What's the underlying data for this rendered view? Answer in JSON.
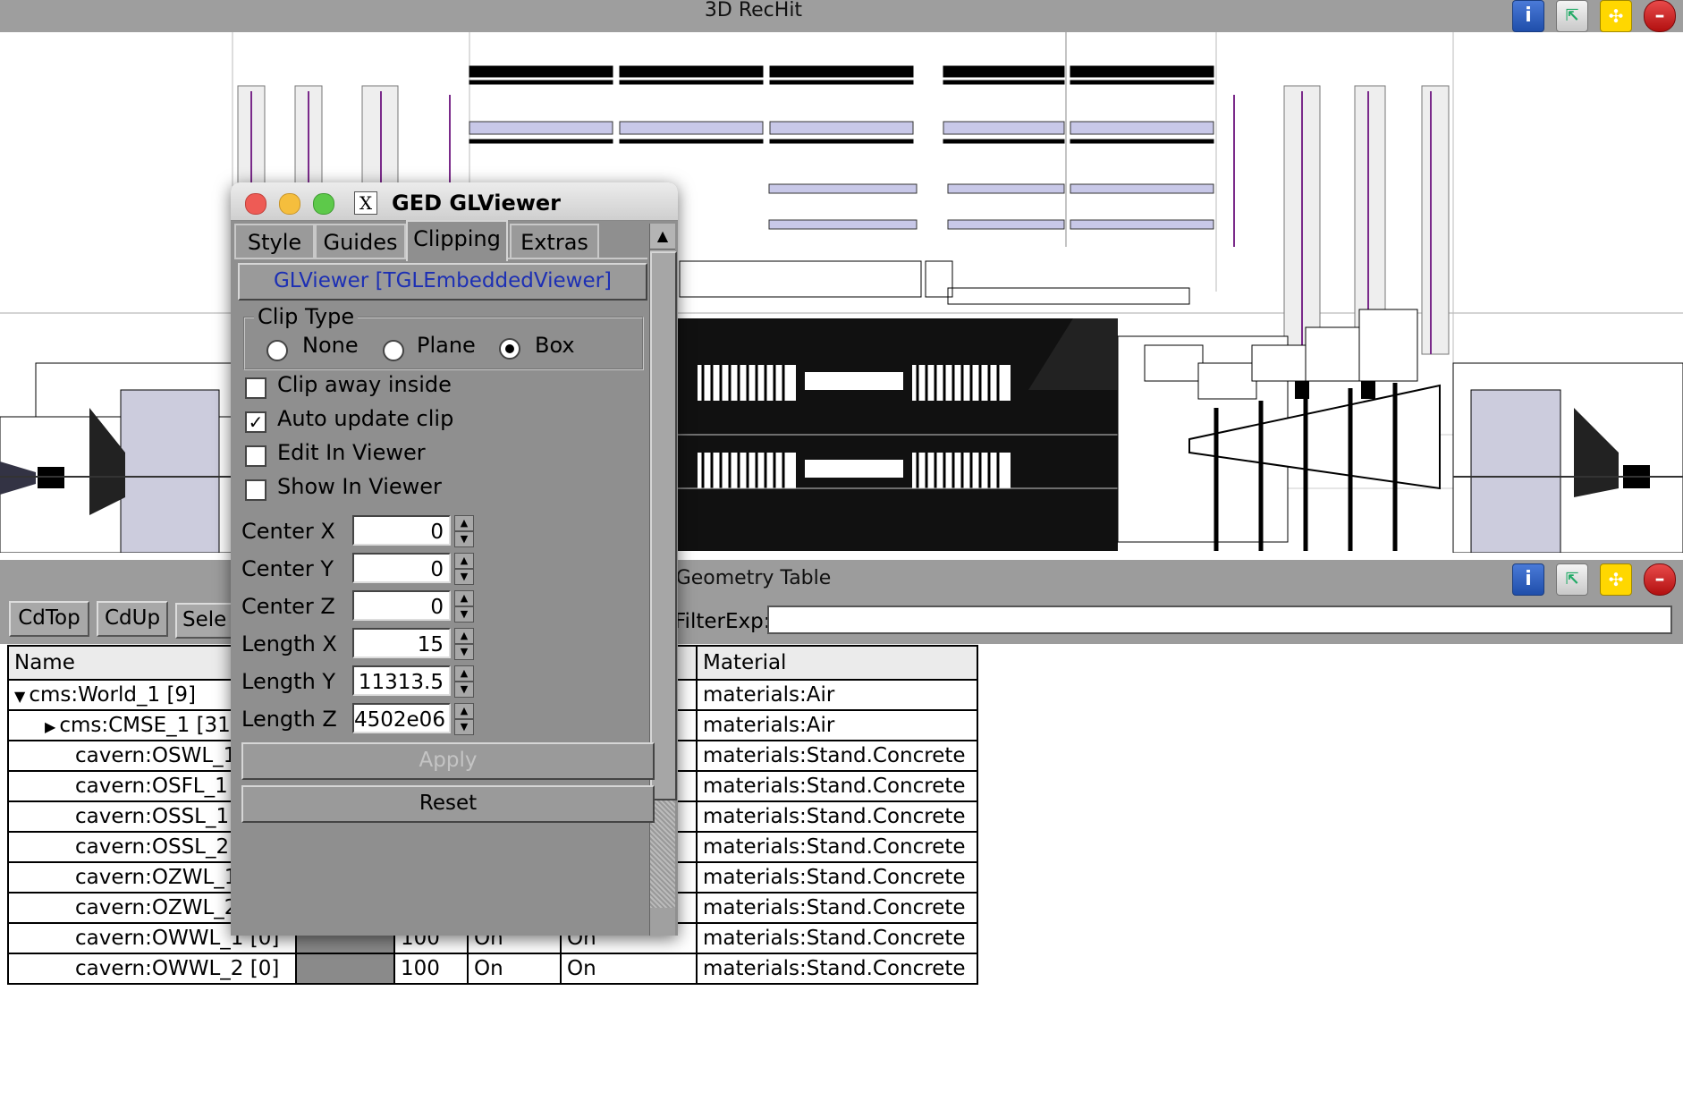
{
  "viewer": {
    "title": "3D RecHit",
    "buttons": {
      "info_icon": "info-icon",
      "undock_icon": "undock-icon",
      "maximize_icon": "maximize-icon",
      "close_icon": "close-icon"
    }
  },
  "geometry_table": {
    "title": "Geometry Table",
    "cdtop_label": "CdTop",
    "cdup_label": "CdUp",
    "select_label": "Sele",
    "filter_label": "FilterExp:",
    "filter_value": "",
    "columns": {
      "name": "Name",
      "material": "Material"
    },
    "rows": [
      {
        "name": "cms:World_1 [9]",
        "expander": "▼",
        "indent": 0,
        "vis": "",
        "c1": "",
        "c2": "",
        "material": "materials:Air"
      },
      {
        "name": "cms:CMSE_1 [31",
        "expander": "▶",
        "indent": 1,
        "vis": "",
        "c1": "",
        "c2": "",
        "material": "materials:Air"
      },
      {
        "name": "cavern:OSWL_1",
        "expander": "",
        "indent": 2,
        "vis": "",
        "c1": "",
        "c2": "",
        "material": "materials:Stand.Concrete"
      },
      {
        "name": "cavern:OSFL_1 [",
        "expander": "",
        "indent": 2,
        "vis": "",
        "c1": "",
        "c2": "",
        "material": "materials:Stand.Concrete"
      },
      {
        "name": "cavern:OSSL_1 [",
        "expander": "",
        "indent": 2,
        "vis": "",
        "c1": "",
        "c2": "",
        "material": "materials:Stand.Concrete"
      },
      {
        "name": "cavern:OSSL_2 [",
        "expander": "",
        "indent": 2,
        "vis": "",
        "c1": "",
        "c2": "",
        "material": "materials:Stand.Concrete"
      },
      {
        "name": "cavern:OZWL_1",
        "expander": "",
        "indent": 2,
        "vis": "",
        "c1": "",
        "c2": "",
        "material": "materials:Stand.Concrete"
      },
      {
        "name": "cavern:OZWL_2",
        "expander": "",
        "indent": 2,
        "vis": "",
        "c1": "",
        "c2": "",
        "material": "materials:Stand.Concrete"
      },
      {
        "name": "cavern:OWWL_1 [0]",
        "expander": "",
        "indent": 2,
        "vis": "100",
        "c1": "On",
        "c2": "On",
        "material": "materials:Stand.Concrete"
      },
      {
        "name": "cavern:OWWL_2 [0]",
        "expander": "",
        "indent": 2,
        "vis": "100",
        "c1": "On",
        "c2": "On",
        "material": "materials:Stand.Concrete"
      }
    ]
  },
  "dialog": {
    "title": "GED GLViewer",
    "x_icon": "X",
    "tabs": [
      "Style",
      "Guides",
      "Clipping",
      "Extras"
    ],
    "active_tab": "Clipping",
    "viewer_button": "GLViewer [TGLEmbeddedViewer]",
    "clip_type": {
      "label": "Clip Type",
      "options": [
        "None",
        "Plane",
        "Box"
      ],
      "selected": "Box"
    },
    "checkboxes": [
      {
        "label": "Clip away inside",
        "checked": false
      },
      {
        "label": "Auto update clip",
        "checked": true
      },
      {
        "label": "Edit In Viewer",
        "checked": false
      },
      {
        "label": "Show In Viewer",
        "checked": false
      }
    ],
    "fields": [
      {
        "label": "Center X",
        "value": "0"
      },
      {
        "label": "Center Y",
        "value": "0"
      },
      {
        "label": "Center Z",
        "value": "0"
      },
      {
        "label": "Length X",
        "value": "15"
      },
      {
        "label": "Length Y",
        "value": "11313.5"
      },
      {
        "label": "Length Z",
        "value": "4502e06"
      }
    ],
    "apply_label": "Apply",
    "reset_label": "Reset"
  }
}
